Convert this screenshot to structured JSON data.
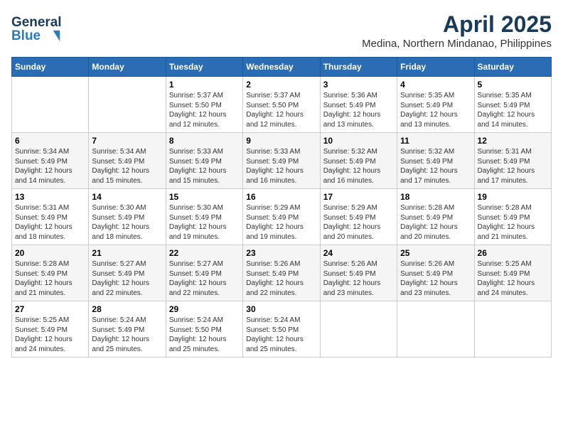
{
  "header": {
    "logo_line1": "General",
    "logo_line2": "Blue",
    "title": "April 2025",
    "subtitle": "Medina, Northern Mindanao, Philippines"
  },
  "calendar": {
    "days_of_week": [
      "Sunday",
      "Monday",
      "Tuesday",
      "Wednesday",
      "Thursday",
      "Friday",
      "Saturday"
    ],
    "weeks": [
      [
        {
          "day": "",
          "info": ""
        },
        {
          "day": "",
          "info": ""
        },
        {
          "day": "1",
          "info": "Sunrise: 5:37 AM\nSunset: 5:50 PM\nDaylight: 12 hours and 12 minutes."
        },
        {
          "day": "2",
          "info": "Sunrise: 5:37 AM\nSunset: 5:50 PM\nDaylight: 12 hours and 12 minutes."
        },
        {
          "day": "3",
          "info": "Sunrise: 5:36 AM\nSunset: 5:49 PM\nDaylight: 12 hours and 13 minutes."
        },
        {
          "day": "4",
          "info": "Sunrise: 5:35 AM\nSunset: 5:49 PM\nDaylight: 12 hours and 13 minutes."
        },
        {
          "day": "5",
          "info": "Sunrise: 5:35 AM\nSunset: 5:49 PM\nDaylight: 12 hours and 14 minutes."
        }
      ],
      [
        {
          "day": "6",
          "info": "Sunrise: 5:34 AM\nSunset: 5:49 PM\nDaylight: 12 hours and 14 minutes."
        },
        {
          "day": "7",
          "info": "Sunrise: 5:34 AM\nSunset: 5:49 PM\nDaylight: 12 hours and 15 minutes."
        },
        {
          "day": "8",
          "info": "Sunrise: 5:33 AM\nSunset: 5:49 PM\nDaylight: 12 hours and 15 minutes."
        },
        {
          "day": "9",
          "info": "Sunrise: 5:33 AM\nSunset: 5:49 PM\nDaylight: 12 hours and 16 minutes."
        },
        {
          "day": "10",
          "info": "Sunrise: 5:32 AM\nSunset: 5:49 PM\nDaylight: 12 hours and 16 minutes."
        },
        {
          "day": "11",
          "info": "Sunrise: 5:32 AM\nSunset: 5:49 PM\nDaylight: 12 hours and 17 minutes."
        },
        {
          "day": "12",
          "info": "Sunrise: 5:31 AM\nSunset: 5:49 PM\nDaylight: 12 hours and 17 minutes."
        }
      ],
      [
        {
          "day": "13",
          "info": "Sunrise: 5:31 AM\nSunset: 5:49 PM\nDaylight: 12 hours and 18 minutes."
        },
        {
          "day": "14",
          "info": "Sunrise: 5:30 AM\nSunset: 5:49 PM\nDaylight: 12 hours and 18 minutes."
        },
        {
          "day": "15",
          "info": "Sunrise: 5:30 AM\nSunset: 5:49 PM\nDaylight: 12 hours and 19 minutes."
        },
        {
          "day": "16",
          "info": "Sunrise: 5:29 AM\nSunset: 5:49 PM\nDaylight: 12 hours and 19 minutes."
        },
        {
          "day": "17",
          "info": "Sunrise: 5:29 AM\nSunset: 5:49 PM\nDaylight: 12 hours and 20 minutes."
        },
        {
          "day": "18",
          "info": "Sunrise: 5:28 AM\nSunset: 5:49 PM\nDaylight: 12 hours and 20 minutes."
        },
        {
          "day": "19",
          "info": "Sunrise: 5:28 AM\nSunset: 5:49 PM\nDaylight: 12 hours and 21 minutes."
        }
      ],
      [
        {
          "day": "20",
          "info": "Sunrise: 5:28 AM\nSunset: 5:49 PM\nDaylight: 12 hours and 21 minutes."
        },
        {
          "day": "21",
          "info": "Sunrise: 5:27 AM\nSunset: 5:49 PM\nDaylight: 12 hours and 22 minutes."
        },
        {
          "day": "22",
          "info": "Sunrise: 5:27 AM\nSunset: 5:49 PM\nDaylight: 12 hours and 22 minutes."
        },
        {
          "day": "23",
          "info": "Sunrise: 5:26 AM\nSunset: 5:49 PM\nDaylight: 12 hours and 22 minutes."
        },
        {
          "day": "24",
          "info": "Sunrise: 5:26 AM\nSunset: 5:49 PM\nDaylight: 12 hours and 23 minutes."
        },
        {
          "day": "25",
          "info": "Sunrise: 5:26 AM\nSunset: 5:49 PM\nDaylight: 12 hours and 23 minutes."
        },
        {
          "day": "26",
          "info": "Sunrise: 5:25 AM\nSunset: 5:49 PM\nDaylight: 12 hours and 24 minutes."
        }
      ],
      [
        {
          "day": "27",
          "info": "Sunrise: 5:25 AM\nSunset: 5:49 PM\nDaylight: 12 hours and 24 minutes."
        },
        {
          "day": "28",
          "info": "Sunrise: 5:24 AM\nSunset: 5:49 PM\nDaylight: 12 hours and 25 minutes."
        },
        {
          "day": "29",
          "info": "Sunrise: 5:24 AM\nSunset: 5:50 PM\nDaylight: 12 hours and 25 minutes."
        },
        {
          "day": "30",
          "info": "Sunrise: 5:24 AM\nSunset: 5:50 PM\nDaylight: 12 hours and 25 minutes."
        },
        {
          "day": "",
          "info": ""
        },
        {
          "day": "",
          "info": ""
        },
        {
          "day": "",
          "info": ""
        }
      ]
    ]
  }
}
